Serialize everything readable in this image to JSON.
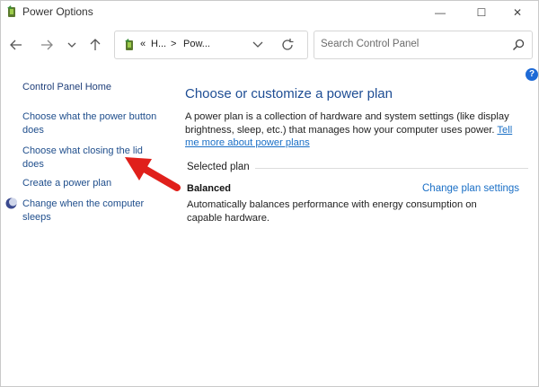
{
  "window": {
    "title": "Power Options",
    "minimize_glyph": "—",
    "maximize_glyph": "☐",
    "close_glyph": "✕"
  },
  "nav": {
    "back_glyph": "←",
    "forward_glyph": "→",
    "recent_glyph": "⌄",
    "up_glyph": "↑"
  },
  "address": {
    "overflow": "«",
    "parts": [
      "H...",
      "Pow..."
    ],
    "separator": ">"
  },
  "search": {
    "placeholder": "Search Control Panel"
  },
  "left_pane": {
    "home": "Control Panel Home",
    "links": [
      "Choose what the power button does",
      "Choose what closing the lid does",
      "Create a power plan",
      "Change when the computer sleeps"
    ]
  },
  "main": {
    "heading": "Choose or customize a power plan",
    "description": "A power plan is a collection of hardware and system settings (like display brightness, sleep, etc.) that manages how your computer uses power.",
    "description_link": "Tell me more about power plans",
    "section_label": "Selected plan",
    "plan": {
      "name": "Balanced",
      "settings_link": "Change plan settings",
      "description": "Automatically balances performance with energy consumption on capable hardware."
    }
  },
  "help_glyph": "?",
  "colors": {
    "heading": "#1e4d94",
    "link": "#1a6fc6",
    "annotation_arrow": "#e0201b"
  },
  "icons": [
    "power-options-icon",
    "back-arrow-icon",
    "forward-arrow-icon",
    "recent-pages-icon",
    "up-arrow-icon",
    "refresh-icon",
    "search-icon",
    "chevron-down-icon",
    "sleep-moon-icon",
    "help-icon",
    "annotation-arrow"
  ]
}
